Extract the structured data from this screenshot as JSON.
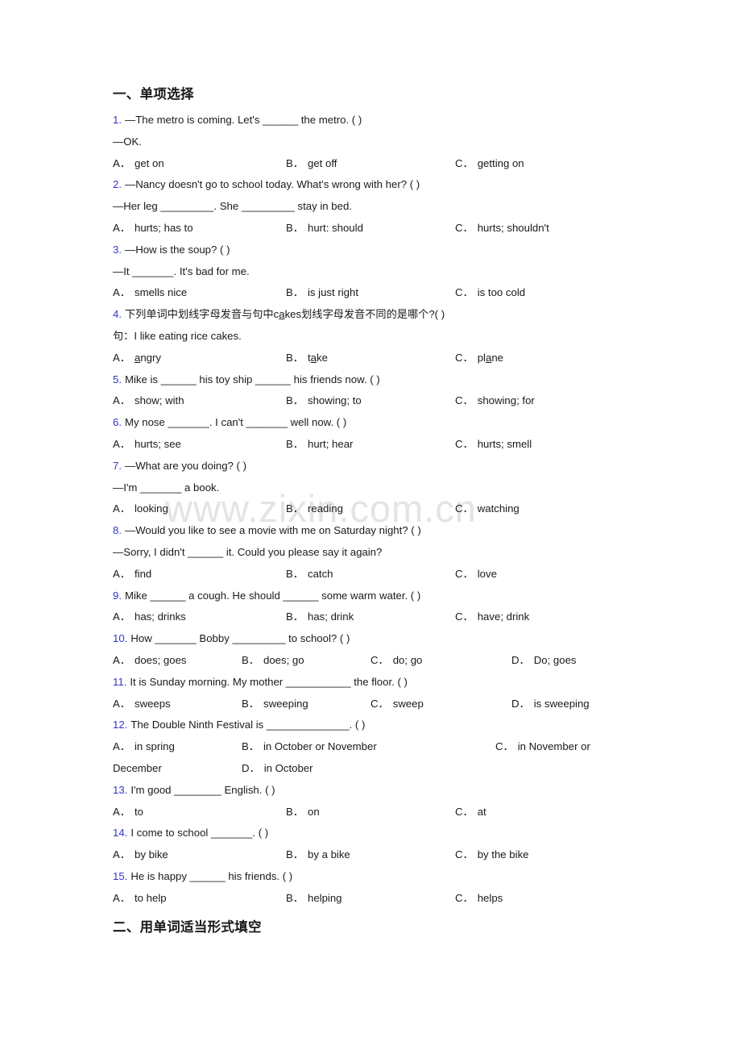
{
  "watermark": {
    "text": "www.zixin.com.cn",
    "color": "#e4e4e4"
  },
  "accent_number_color": "#3333cc",
  "sections": [
    {
      "heading": "一、单项选择"
    },
    {
      "heading": "二、用单词适当形式填空"
    }
  ],
  "questions": [
    {
      "num": "1.",
      "stem": "—The metro is coming. Let's ______ the metro. (    )",
      "cont": "—OK.",
      "options": [
        {
          "label": "A．",
          "text": "get on"
        },
        {
          "label": "B．",
          "text": "get off"
        },
        {
          "label": "C．",
          "text": "getting on"
        }
      ]
    },
    {
      "num": "2.",
      "stem": "—Nancy doesn't go to school today. What's wrong with her? (    )",
      "cont": "—Her leg _________. She _________ stay in bed.",
      "options": [
        {
          "label": "A．",
          "text": "hurts; has to"
        },
        {
          "label": "B．",
          "text": "hurt: should"
        },
        {
          "label": "C．",
          "text": "hurts; shouldn't"
        }
      ]
    },
    {
      "num": "3.",
      "stem": "—How is the soup? (  )",
      "cont": "—It _______. It's bad for me.",
      "options": [
        {
          "label": "A．",
          "text": "smells nice"
        },
        {
          "label": "B．",
          "text": "is just right"
        },
        {
          "label": "C．",
          "text": "is too cold"
        }
      ]
    },
    {
      "num": "4.",
      "stem_pre": "下列单词中划线字母发音与句中c",
      "stem_underline": "a",
      "stem_post": "kes划线字母发音不同的是哪个?( )",
      "cont": "句：I like eating rice cakes.",
      "options": [
        {
          "label": "A．",
          "pre": "",
          "u": "a",
          "post": "ngry"
        },
        {
          "label": "B．",
          "pre": "t",
          "u": "a",
          "post": "ke"
        },
        {
          "label": "C．",
          "pre": "pl",
          "u": "a",
          "post": "ne"
        }
      ]
    },
    {
      "num": "5.",
      "stem": "Mike is ______ his toy ship ______ his friends now. (  )",
      "options": [
        {
          "label": "A．",
          "text": "show; with"
        },
        {
          "label": "B．",
          "text": "showing; to"
        },
        {
          "label": "C．",
          "text": "showing; for"
        }
      ]
    },
    {
      "num": "6.",
      "stem": "My nose _______. I can't _______ well now. (    )",
      "options": [
        {
          "label": "A．",
          "text": "hurts; see"
        },
        {
          "label": "B．",
          "text": "hurt; hear"
        },
        {
          "label": "C．",
          "text": "hurts; smell"
        }
      ]
    },
    {
      "num": "7.",
      "stem": "—What are you doing? (       )",
      "cont": "—I'm _______ a book.",
      "options": [
        {
          "label": "A．",
          "text": "looking"
        },
        {
          "label": "B．",
          "text": "reading"
        },
        {
          "label": "C．",
          "text": "watching"
        }
      ]
    },
    {
      "num": "8.",
      "stem": "—Would you like to see a movie with me on Saturday night? (  )",
      "cont": "—Sorry, I didn't ______ it. Could you please say it again?",
      "options": [
        {
          "label": "A．",
          "text": "find"
        },
        {
          "label": "B．",
          "text": "catch"
        },
        {
          "label": "C．",
          "text": "love"
        }
      ]
    },
    {
      "num": "9.",
      "stem": "Mike ______ a cough. He should ______ some warm water. (  )",
      "options": [
        {
          "label": "A．",
          "text": "has; drinks"
        },
        {
          "label": "B．",
          "text": "has; drink"
        },
        {
          "label": "C．",
          "text": "have; drink"
        }
      ]
    },
    {
      "num": "10.",
      "stem": "How _______ Bobby _________ to school? (  )",
      "options": [
        {
          "label": "A．",
          "text": "does; goes"
        },
        {
          "label": "B．",
          "text": "does; go"
        },
        {
          "label": "C．",
          "text": "do; go"
        },
        {
          "label": "D．",
          "text": "Do; goes"
        }
      ]
    },
    {
      "num": "11.",
      "stem": "It is Sunday morning. My mother ___________ the floor. (  )",
      "options": [
        {
          "label": "A．",
          "text": "sweeps"
        },
        {
          "label": "B．",
          "text": "sweeping"
        },
        {
          "label": "C．",
          "text": "sweep"
        },
        {
          "label": "D．",
          "text": "is sweeping"
        }
      ]
    },
    {
      "num": "12.",
      "stem": "The Double Ninth Festival is ______________. (  )",
      "options": [
        {
          "label": "A．",
          "text": "in spring"
        },
        {
          "label": "B．",
          "text": "in October or November"
        },
        {
          "label": "C．",
          "text": "in November or"
        },
        {
          "label": "D．",
          "text": "in October"
        }
      ],
      "wrap_text": "December"
    },
    {
      "num": "13.",
      "stem": "I'm good ________ English. (  )",
      "options": [
        {
          "label": "A．",
          "text": "to"
        },
        {
          "label": "B．",
          "text": "on"
        },
        {
          "label": "C．",
          "text": "at"
        }
      ]
    },
    {
      "num": "14.",
      "stem": "I come to school _______. (  )",
      "options": [
        {
          "label": "A．",
          "text": "by bike"
        },
        {
          "label": "B．",
          "text": "by a bike"
        },
        {
          "label": "C．",
          "text": "by the bike"
        }
      ]
    },
    {
      "num": "15.",
      "stem": "He is happy ______ his friends. (    )",
      "options": [
        {
          "label": "A．",
          "text": "to help"
        },
        {
          "label": "B．",
          "text": "helping"
        },
        {
          "label": "C．",
          "text": "helps"
        }
      ]
    }
  ]
}
